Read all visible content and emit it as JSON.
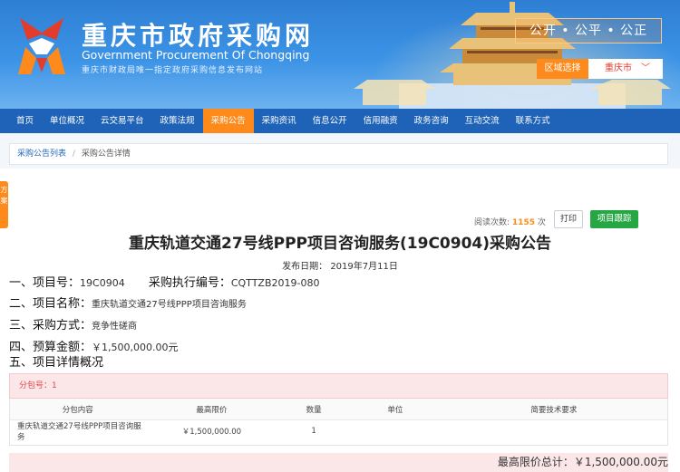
{
  "header": {
    "site_name_cn": "重庆市政府采购网",
    "site_name_en": "Government Procurement Of Chongqing",
    "site_tagline": "重庆市财政局唯一指定政府采购信息发布网站",
    "motto": "公开 • 公平 • 公正",
    "region_label": "区域选择",
    "region_value": "重庆市"
  },
  "nav": {
    "items": [
      {
        "label": "首页"
      },
      {
        "label": "单位概况"
      },
      {
        "label": "云交易平台"
      },
      {
        "label": "政策法规"
      },
      {
        "label": "采购公告"
      },
      {
        "label": "采购资讯"
      },
      {
        "label": "信息公开"
      },
      {
        "label": "信用融资"
      },
      {
        "label": "政务咨询"
      },
      {
        "label": "互动交流"
      },
      {
        "label": "联系方式"
      }
    ],
    "active_index": 4,
    "active_color": "#ff8a1c"
  },
  "breadcrumb": {
    "link": "采购公告列表",
    "separator": "/",
    "current": "采购公告详情"
  },
  "sidetab": {
    "label": "方案"
  },
  "toolbar": {
    "read_label": "阅读次数:",
    "read_count": "1155",
    "read_unit": "次",
    "print_label": "打印",
    "track_label": "项目跟踪"
  },
  "notice": {
    "title": "重庆轨道交通27号线PPP项目咨询服务(19C0904)采购公告",
    "publish_label": "发布日期：",
    "publish_date": "2019年7月11日",
    "sections": {
      "s1_label": "一、项目号：",
      "s1_value": "19C0904",
      "s1b_label": "采购执行编号：",
      "s1b_value": "CQTTZB2019-080",
      "s2_label": "二、项目名称：",
      "s2_value": "重庆轨道交通27号线PPP项目咨询服务",
      "s3_label": "三、采购方式：",
      "s3_value": "竞争性磋商",
      "s4_label": "四、预算金额：",
      "s4_value": "￥1,500,000.00元",
      "s5_label": "五、项目详情概况"
    }
  },
  "package": {
    "label": "分包号：1",
    "headers": [
      "分包内容",
      "最高限价",
      "数量",
      "单位",
      "简要技术要求"
    ],
    "rows": [
      {
        "content": "重庆轨道交通27号线PPP项目咨询服务",
        "price": "￥1,500,000.00",
        "qty": "1",
        "unit": "",
        "req": ""
      }
    ]
  },
  "total": {
    "label": "最高限价总计：",
    "value": "￥1,500,000.00元"
  }
}
